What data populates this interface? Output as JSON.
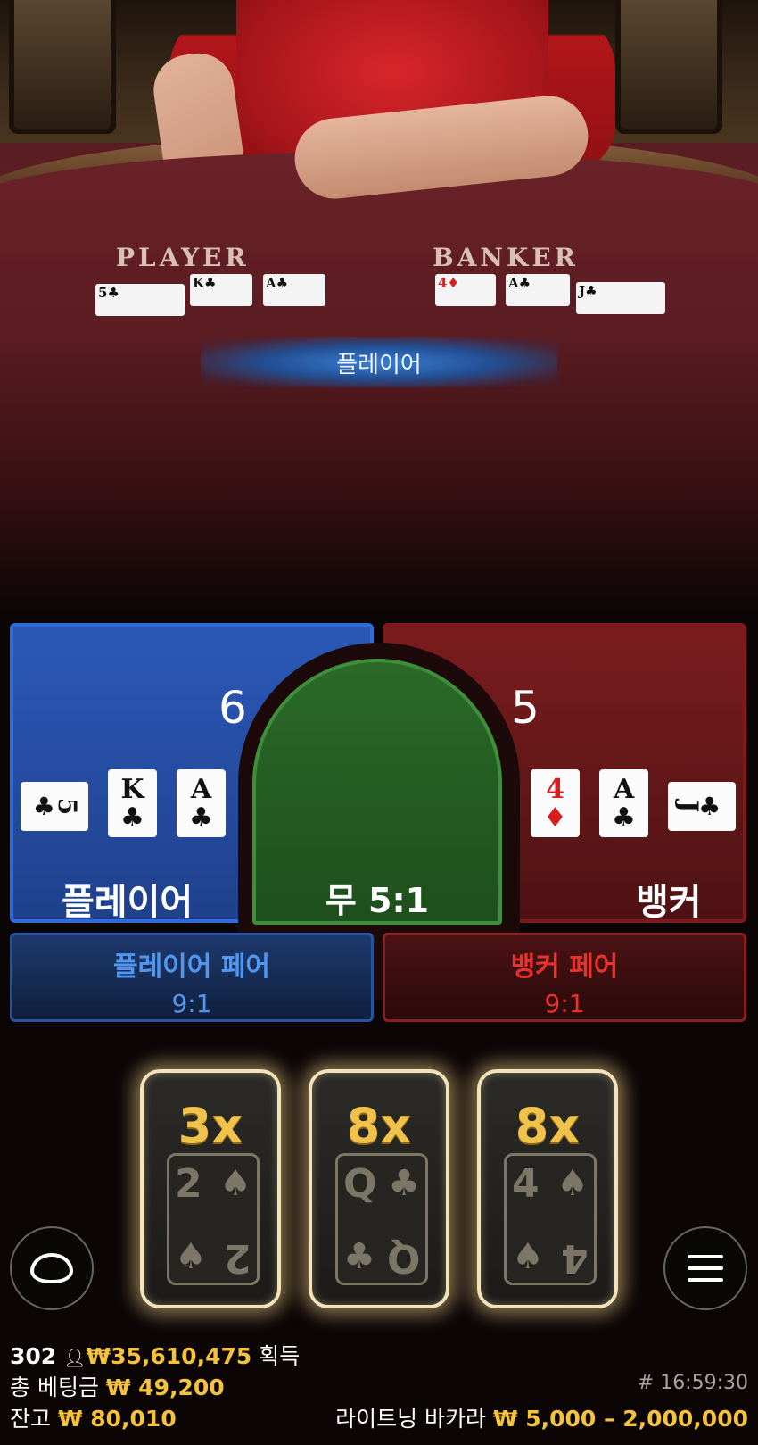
{
  "table": {
    "player_text": "PLAYER",
    "banker_text": "BANKER",
    "player_cards": [
      {
        "rank": "5",
        "suit": "♣",
        "color": "black"
      },
      {
        "rank": "K",
        "suit": "♣",
        "color": "black"
      },
      {
        "rank": "A",
        "suit": "♣",
        "color": "black"
      }
    ],
    "banker_cards": [
      {
        "rank": "4",
        "suit": "♦",
        "color": "red"
      },
      {
        "rank": "A",
        "suit": "♣",
        "color": "black"
      },
      {
        "rank": "J",
        "suit": "♣",
        "color": "black"
      }
    ],
    "result_banner": "플레이어"
  },
  "bets": {
    "player": {
      "score": "6",
      "label": "플레이어",
      "cards": [
        {
          "rank": "5",
          "suit": "♣"
        },
        {
          "rank": "K",
          "suit": "♣"
        },
        {
          "rank": "A",
          "suit": "♣"
        }
      ]
    },
    "tie": {
      "label": "무 5:1"
    },
    "banker": {
      "score": "5",
      "label": "뱅커",
      "cards": [
        {
          "rank": "4",
          "suit": "♦"
        },
        {
          "rank": "A",
          "suit": "♣"
        },
        {
          "rank": "J",
          "suit": "♣"
        }
      ]
    },
    "player_pair": {
      "title": "플레이어 페어",
      "odds": "9:1"
    },
    "banker_pair": {
      "title": "뱅커 페어",
      "odds": "9:1"
    }
  },
  "lightning_cards": [
    {
      "multiplier": "3x",
      "rank": "2",
      "suit": "♠"
    },
    {
      "multiplier": "8x",
      "rank": "Q",
      "suit": "♣"
    },
    {
      "multiplier": "8x",
      "rank": "4",
      "suit": "♠"
    }
  ],
  "footer": {
    "players": "302",
    "players_icon": "person-icon",
    "winnings": "₩35,610,475",
    "winnings_label": "획득",
    "total_bet_label": "총 베팅금",
    "total_bet": "₩ 49,200",
    "round_id": "# 16:59:30",
    "balance_label": "잔고",
    "balance": "₩ 80,010",
    "game_name": "라이트닝 바카라",
    "limits": "₩ 5,000 – 2,000,000"
  },
  "colors": {
    "player_blue": "#2f6bda",
    "banker_red": "#7d1a1b",
    "tie_green": "#3f8f3a",
    "gold": "#f4c33b",
    "multiplier_gold": "#f0c24a"
  }
}
